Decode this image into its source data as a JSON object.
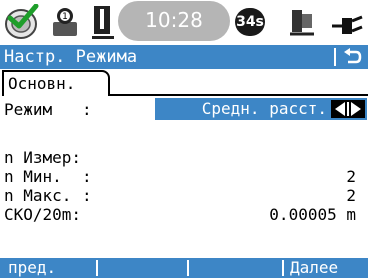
{
  "statusbar": {
    "time": "10:28",
    "badge": "34s",
    "icons": [
      "prism-icon",
      "user-icon",
      "level-icon",
      "instrument-icon",
      "power-plug-icon"
    ]
  },
  "titlebar": {
    "title": "Настр. Режима"
  },
  "tab": {
    "label": "Основн."
  },
  "fields": {
    "mode_label": "Режим",
    "mode_colon": ":",
    "mode_value": "Средн. расст.",
    "n_measure_label": "n Измер:",
    "n_min_label": "n Мин.",
    "n_min_value": "2",
    "n_max_label": "n Макс.",
    "n_max_value": "2",
    "sko_label": "СКО/20m:",
    "sko_value": "0.00005 m",
    "colon": ":"
  },
  "fkeys": {
    "f1": "пред.",
    "f6": "Далее"
  },
  "colors": {
    "accent": "#3d86c6",
    "oval": "#b5b5b5"
  }
}
